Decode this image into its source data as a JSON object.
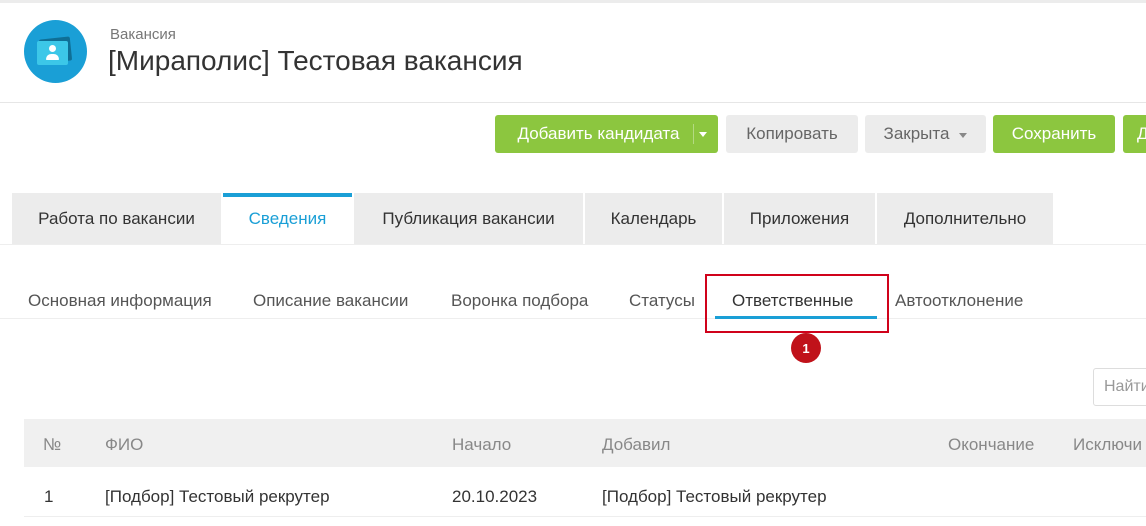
{
  "header": {
    "breadcrumb": "Вакансия",
    "title": "[Мираполис] Тестовая вакансия",
    "icon": "vacancy-card-icon"
  },
  "toolbar": {
    "add_candidate": "Добавить кандидата",
    "copy": "Копировать",
    "status": "Закрыта",
    "save": "Сохранить",
    "more": "Д"
  },
  "main_tabs": [
    {
      "label": "Работа по вакансии",
      "active": false
    },
    {
      "label": "Сведения",
      "active": true
    },
    {
      "label": "Публикация вакансии",
      "active": false
    },
    {
      "label": "Календарь",
      "active": false
    },
    {
      "label": "Приложения",
      "active": false
    },
    {
      "label": "Дополнительно",
      "active": false
    }
  ],
  "sub_tabs": [
    {
      "label": "Основная информация",
      "active": false
    },
    {
      "label": "Описание вакансии",
      "active": false
    },
    {
      "label": "Воронка подбора",
      "active": false
    },
    {
      "label": "Статусы",
      "active": false
    },
    {
      "label": "Ответственные",
      "active": true
    },
    {
      "label": "Автоотклонение",
      "active": false
    }
  ],
  "annotation": {
    "marker": "1"
  },
  "search": {
    "placeholder": "Найти"
  },
  "table": {
    "columns": [
      "№",
      "ФИО",
      "Начало",
      "Добавил",
      "Окончание",
      "Исключи"
    ],
    "rows": [
      [
        "1",
        "[Подбор] Тестовый рекрутер",
        "20.10.2023",
        "[Подбор] Тестовый рекрутер",
        "",
        ""
      ]
    ]
  },
  "colors": {
    "accent": "#1a9fd6",
    "primary_button": "#8cc63f",
    "annotation": "#d0021b"
  }
}
